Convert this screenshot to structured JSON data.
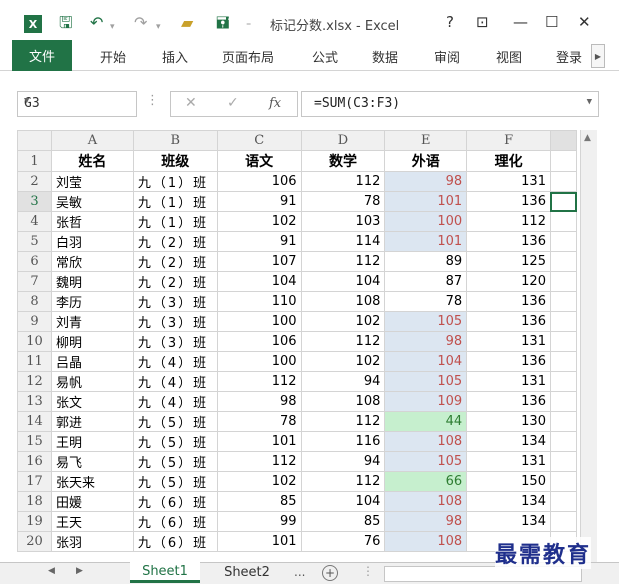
{
  "window": {
    "title": "标记分数.xlsx - Excel",
    "app_logo": "X",
    "controls": {
      "help": "?",
      "restore_ribbon": "⊡",
      "minimize": "—",
      "maximize": "☐",
      "close": "✕"
    },
    "accent_color": "#217346"
  },
  "ribbon": {
    "tabs": [
      "文件",
      "开始",
      "插入",
      "页面布局",
      "公式",
      "数据",
      "审阅",
      "视图",
      "登录"
    ]
  },
  "formula_bar": {
    "name_box": "G3",
    "formula": "=SUM(C3:F3)"
  },
  "sheet": {
    "columns": [
      "A",
      "B",
      "C",
      "D",
      "E",
      "F"
    ],
    "headers": [
      "姓名",
      "班级",
      "语文",
      "数学",
      "外语",
      "理化"
    ],
    "rows": [
      {
        "n": "2",
        "name": "刘莹",
        "cls": "九（1）班",
        "c": "106",
        "d": "112",
        "e": "98",
        "f": "131",
        "e_style": "blue-red"
      },
      {
        "n": "3",
        "name": "吴敏",
        "cls": "九（1）班",
        "c": "91",
        "d": "78",
        "e": "101",
        "f": "136",
        "e_style": "blue-red"
      },
      {
        "n": "4",
        "name": "张哲",
        "cls": "九（1）班",
        "c": "102",
        "d": "103",
        "e": "100",
        "f": "112",
        "e_style": "blue-red"
      },
      {
        "n": "5",
        "name": "白羽",
        "cls": "九（2）班",
        "c": "91",
        "d": "114",
        "e": "101",
        "f": "136",
        "e_style": "blue-red"
      },
      {
        "n": "6",
        "name": "常欣",
        "cls": "九（2）班",
        "c": "107",
        "d": "112",
        "e": "89",
        "f": "125",
        "e_style": "plain"
      },
      {
        "n": "7",
        "name": "魏明",
        "cls": "九（2）班",
        "c": "104",
        "d": "104",
        "e": "87",
        "f": "120",
        "e_style": "plain"
      },
      {
        "n": "8",
        "name": "李历",
        "cls": "九（3）班",
        "c": "110",
        "d": "108",
        "e": "78",
        "f": "136",
        "e_style": "plain"
      },
      {
        "n": "9",
        "name": "刘青",
        "cls": "九（3）班",
        "c": "100",
        "d": "102",
        "e": "105",
        "f": "136",
        "e_style": "blue-red"
      },
      {
        "n": "10",
        "name": "柳明",
        "cls": "九（3）班",
        "c": "106",
        "d": "112",
        "e": "98",
        "f": "131",
        "e_style": "blue-red"
      },
      {
        "n": "11",
        "name": "吕晶",
        "cls": "九（4）班",
        "c": "100",
        "d": "102",
        "e": "104",
        "f": "136",
        "e_style": "blue-red"
      },
      {
        "n": "12",
        "name": "易帆",
        "cls": "九（4）班",
        "c": "112",
        "d": "94",
        "e": "105",
        "f": "131",
        "e_style": "blue-red"
      },
      {
        "n": "13",
        "name": "张文",
        "cls": "九（4）班",
        "c": "98",
        "d": "108",
        "e": "109",
        "f": "136",
        "e_style": "blue-red"
      },
      {
        "n": "14",
        "name": "郭进",
        "cls": "九（5）班",
        "c": "78",
        "d": "112",
        "e": "44",
        "f": "130",
        "e_style": "green"
      },
      {
        "n": "15",
        "name": "王明",
        "cls": "九（5）班",
        "c": "101",
        "d": "116",
        "e": "108",
        "f": "134",
        "e_style": "blue-red"
      },
      {
        "n": "16",
        "name": "易飞",
        "cls": "九（5）班",
        "c": "112",
        "d": "94",
        "e": "105",
        "f": "131",
        "e_style": "blue-red"
      },
      {
        "n": "17",
        "name": "张天来",
        "cls": "九（5）班",
        "c": "102",
        "d": "112",
        "e": "66",
        "f": "150",
        "e_style": "green"
      },
      {
        "n": "18",
        "name": "田媛",
        "cls": "九（6）班",
        "c": "85",
        "d": "104",
        "e": "108",
        "f": "134",
        "e_style": "blue-red"
      },
      {
        "n": "19",
        "name": "王天",
        "cls": "九（6）班",
        "c": "99",
        "d": "85",
        "e": "98",
        "f": "134",
        "e_style": "blue-red"
      },
      {
        "n": "20",
        "name": "张羽",
        "cls": "九（6）班",
        "c": "101",
        "d": "76",
        "e": "108",
        "f": "",
        "e_style": "blue-red"
      }
    ]
  },
  "sheet_tabs": {
    "active": "Sheet1",
    "other": "Sheet2",
    "more": "...",
    "add": "+"
  },
  "watermark": "最需教育",
  "colors": {
    "highlight_blue": "#dce6f1",
    "highlight_green": "#c6efce",
    "red_text": "#c0504d"
  }
}
